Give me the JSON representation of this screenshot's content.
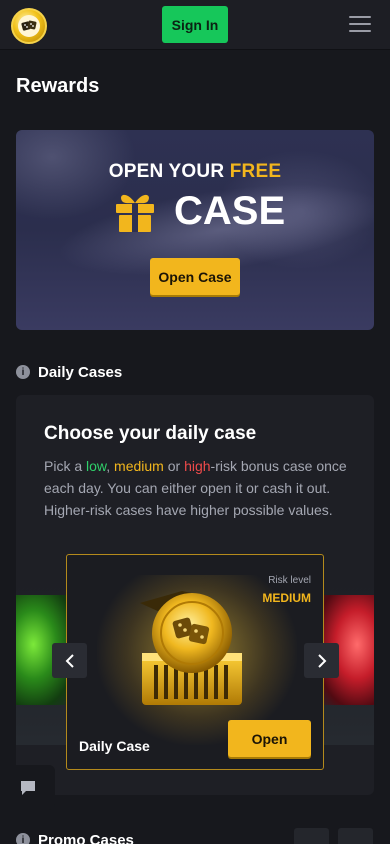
{
  "header": {
    "sign_in_label": "Sign In",
    "logo_icon": "dice-logo-icon",
    "menu_icon": "hamburger-menu-icon"
  },
  "page": {
    "title": "Rewards"
  },
  "banner": {
    "line1_prefix": "OPEN YOUR ",
    "line1_highlight": "FREE",
    "line2": "CASE",
    "gift_icon": "gift-icon",
    "button_label": "Open Case"
  },
  "daily": {
    "section_title": "Daily Cases",
    "heading": "Choose your daily case",
    "desc_before": "Pick a ",
    "low": "low",
    "sep1": ", ",
    "medium": "medium",
    "sep2": " or ",
    "high": "high",
    "desc_after": "-risk bonus case once each day. You can either open it or cash it out. Higher-risk cases have higher possible values.",
    "case": {
      "risk_label": "Risk level",
      "risk_value": "MEDIUM",
      "name": "Daily Case",
      "open_label": "Open"
    }
  },
  "bottom": {
    "section_title": "Promo Cases"
  },
  "colors": {
    "accent_gold": "#f2b61d",
    "sign_in_green": "#16c75a",
    "low_green": "#2fd06a",
    "high_red": "#ef4a4a",
    "background": "#17181d"
  }
}
